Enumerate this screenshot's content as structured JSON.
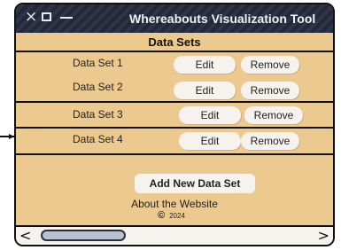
{
  "window": {
    "title": "Whereabouts Visualization Tool",
    "controls": {
      "close": "×"
    }
  },
  "section": {
    "title": "Data Sets"
  },
  "datasets": [
    {
      "label": "Data Set 1",
      "edit": "Edit",
      "remove": "Remove"
    },
    {
      "label": "Data Set 2",
      "edit": "Edit",
      "remove": "Remove"
    },
    {
      "label": "Data Set 3",
      "edit": "Edit",
      "remove": "Remove"
    },
    {
      "label": "Data Set 4",
      "edit": "Edit",
      "remove": "Remove"
    }
  ],
  "actions": {
    "add": "Add New Data Set"
  },
  "footer": {
    "about": "About the Website",
    "copyright_symbol": "©",
    "year": "2024"
  },
  "scrollbar": {
    "left": "<",
    "right": ">"
  },
  "colors": {
    "background": "#ecc98f",
    "titlebar": "#232838",
    "button": "#f6f3ee"
  }
}
